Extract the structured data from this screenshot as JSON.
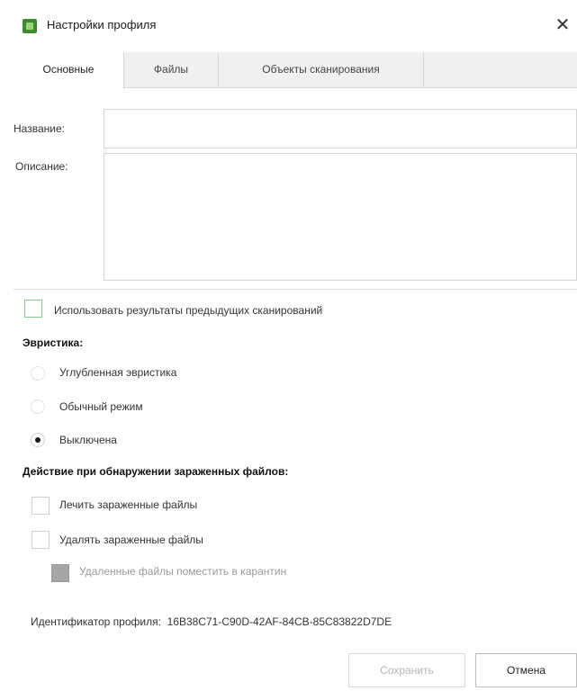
{
  "window": {
    "title": "Настройки профиля",
    "close_glyph": "✕",
    "icon": "app-logo-icon"
  },
  "tabs": [
    {
      "label": "Основные",
      "active": true
    },
    {
      "label": "Файлы",
      "active": false
    },
    {
      "label": "Объекты сканирования",
      "active": false
    }
  ],
  "form": {
    "name_label": "Название:",
    "name_value": "",
    "description_label": "Описание:",
    "description_value": ""
  },
  "use_previous_results": {
    "label": "Использовать результаты предыдущих сканирований",
    "checked": false
  },
  "heuristics": {
    "title": "Эвристика:",
    "options": [
      {
        "label": "Углубленная эвристика",
        "checked": false
      },
      {
        "label": "Обычный режим",
        "checked": false
      },
      {
        "label": "Выключена",
        "checked": true
      }
    ]
  },
  "infected_actions": {
    "title": "Действие при обнаружении зараженных файлов:",
    "options": [
      {
        "label": "Лечить зараженные файлы",
        "checked": false,
        "enabled": true
      },
      {
        "label": "Удалять зараженные файлы",
        "checked": false,
        "enabled": true
      },
      {
        "label": "Удаленные файлы поместить в карантин",
        "checked": false,
        "enabled": false
      }
    ]
  },
  "profile": {
    "id_label": "Идентификатор профиля:",
    "id_value": "16B38C71-C90D-42AF-84CB-85C83822D7DE"
  },
  "buttons": {
    "save": "Сохранить",
    "cancel": "Отмена"
  },
  "colors": {
    "accent_green": "#3d8b2f",
    "tab_bg": "#f0f0f0",
    "disabled_text": "#9a9a9a"
  }
}
